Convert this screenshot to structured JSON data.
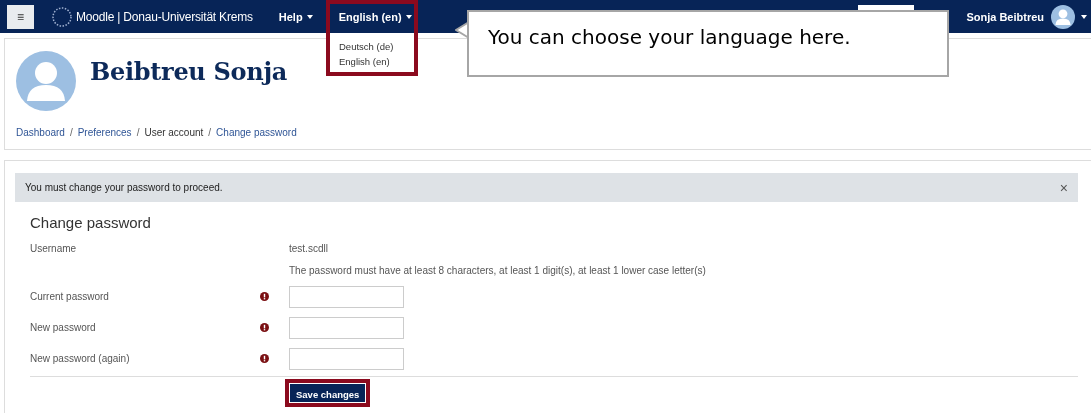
{
  "navbar": {
    "menu_button": "≡",
    "site_name": "Moodle | Donau-Universität Krems",
    "help": "Help",
    "language": "English (en)",
    "user_name": "Sonja Beibtreu"
  },
  "language_menu": {
    "items": [
      {
        "label": "Deutsch (de)"
      },
      {
        "label": "English (en)"
      }
    ]
  },
  "callout": {
    "text": "You can choose your language here."
  },
  "header": {
    "name": "Beibtreu Sonja",
    "separator": "/",
    "breadcrumbs": [
      {
        "label": "Dashboard",
        "kind": "link"
      },
      {
        "label": "Preferences",
        "kind": "link"
      },
      {
        "label": "User account",
        "kind": "current"
      },
      {
        "label": "Change password",
        "kind": "link"
      }
    ]
  },
  "alert": {
    "text": "You must change your password to proceed.",
    "close": "×"
  },
  "form": {
    "title": "Change password",
    "rows": [
      {
        "kind": "static",
        "label": "Username",
        "value": "test.scdll"
      },
      {
        "kind": "note",
        "text": "The password must have at least 8 characters, at least 1 digit(s), at least 1 lower case letter(s)"
      },
      {
        "kind": "password",
        "label": "Current password",
        "required": true
      },
      {
        "kind": "password",
        "label": "New password",
        "required": true
      },
      {
        "kind": "password",
        "label": "New password (again)",
        "required": true
      }
    ],
    "save_button": "Save changes"
  }
}
